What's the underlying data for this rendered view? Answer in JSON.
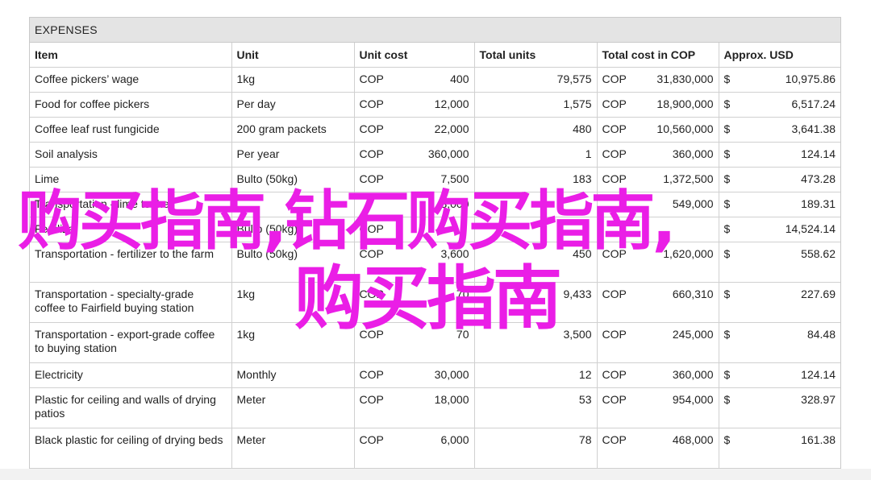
{
  "sheet_title": "EXPENSES",
  "columns": [
    "Item",
    "Unit",
    "Unit cost",
    "Total units",
    "Total cost in COP",
    "Approx. USD"
  ],
  "rows": [
    {
      "item": "Coffee pickers’ wage",
      "unit": "1kg",
      "cost_cur": "COP",
      "cost": "400",
      "units": "79,575",
      "total_cur": "COP",
      "total": "31,830,000",
      "usd_cur": "$",
      "usd": "10,975.86"
    },
    {
      "item": "Food for coffee pickers",
      "unit": "Per day",
      "cost_cur": "COP",
      "cost": "12,000",
      "units": "1,575",
      "total_cur": "COP",
      "total": "18,900,000",
      "usd_cur": "$",
      "usd": "6,517.24"
    },
    {
      "item": "Coffee leaf rust fungicide",
      "unit": "200 gram packets",
      "cost_cur": "COP",
      "cost": "22,000",
      "units": "480",
      "total_cur": "COP",
      "total": "10,560,000",
      "usd_cur": "$",
      "usd": "3,641.38"
    },
    {
      "item": "Soil analysis",
      "unit": "Per year",
      "cost_cur": "COP",
      "cost": "360,000",
      "units": "1",
      "total_cur": "COP",
      "total": "360,000",
      "usd_cur": "$",
      "usd": "124.14"
    },
    {
      "item": "Lime",
      "unit": "Bulto (50kg)",
      "cost_cur": "COP",
      "cost": "7,500",
      "units": "183",
      "total_cur": "COP",
      "total": "1,372,500",
      "usd_cur": "$",
      "usd": "473.28"
    },
    {
      "item": "Transportation - lime to the",
      "unit": "",
      "cost_cur": "",
      "cost": "3,000",
      "units": "",
      "total_cur": "",
      "total": "549,000",
      "usd_cur": "$",
      "usd": "189.31"
    },
    {
      "item": "Fertilizer",
      "unit": "Bulto (50kg)",
      "cost_cur": "COP",
      "cost": "",
      "units": "",
      "total_cur": "",
      "total": "",
      "usd_cur": "$",
      "usd": "14,524.14"
    },
    {
      "item": "Transportation - fertilizer to the farm",
      "unit": "Bulto (50kg)",
      "cost_cur": "COP",
      "cost": "3,600",
      "units": "450",
      "total_cur": "COP",
      "total": "1,620,000",
      "usd_cur": "$",
      "usd": "558.62"
    },
    {
      "item": "Transportation - specialty-grade coffee to Fairfield buying station",
      "unit": "1kg",
      "cost_cur": "COP",
      "cost": "70",
      "units": "9,433",
      "total_cur": "COP",
      "total": "660,310",
      "usd_cur": "$",
      "usd": "227.69"
    },
    {
      "item": "Transportation - export-grade coffee to buying station",
      "unit": "1kg",
      "cost_cur": "COP",
      "cost": "70",
      "units": "3,500",
      "total_cur": "COP",
      "total": "245,000",
      "usd_cur": "$",
      "usd": "84.48"
    },
    {
      "item": "Electricity",
      "unit": "Monthly",
      "cost_cur": "COP",
      "cost": "30,000",
      "units": "12",
      "total_cur": "COP",
      "total": "360,000",
      "usd_cur": "$",
      "usd": "124.14"
    },
    {
      "item": "Plastic for ceiling and walls of drying patios",
      "unit": "Meter",
      "cost_cur": "COP",
      "cost": "18,000",
      "units": "53",
      "total_cur": "COP",
      "total": "954,000",
      "usd_cur": "$",
      "usd": "328.97"
    },
    {
      "item": "Black plastic for ceiling of drying beds",
      "unit": "Meter",
      "cost_cur": "COP",
      "cost": "6,000",
      "units": "78",
      "total_cur": "COP",
      "total": "468,000",
      "usd_cur": "$",
      "usd": "161.38"
    }
  ],
  "overlay": {
    "line1": "购买指南,钻石购买指南,",
    "line2": "购买指南",
    "color": "#ea1ee6"
  }
}
